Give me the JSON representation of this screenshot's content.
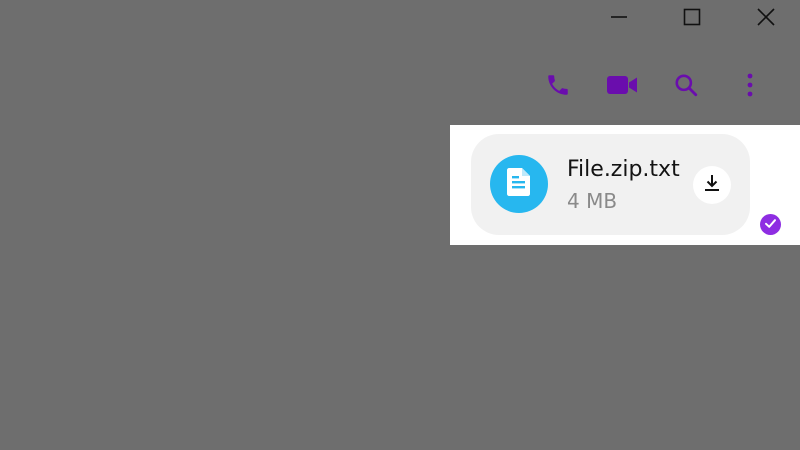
{
  "window_controls": {
    "minimize_icon": "minimize-icon",
    "maximize_icon": "maximize-icon",
    "close_icon": "close-icon"
  },
  "toolbar": {
    "icon_color": "#6a0dad",
    "actions": [
      {
        "name": "voice-call",
        "icon": "phone-icon"
      },
      {
        "name": "video-call",
        "icon": "video-camera-icon"
      },
      {
        "name": "search",
        "icon": "search-icon"
      },
      {
        "name": "more-options",
        "icon": "vertical-ellipsis-icon"
      }
    ]
  },
  "message": {
    "file_name": "File.zip.txt",
    "file_size": "4 MB",
    "file_icon": "document-icon",
    "file_icon_color": "#27b7ef",
    "download_icon": "download-icon",
    "status_icon": "read-check-icon",
    "status_color": "#8e2de2"
  }
}
